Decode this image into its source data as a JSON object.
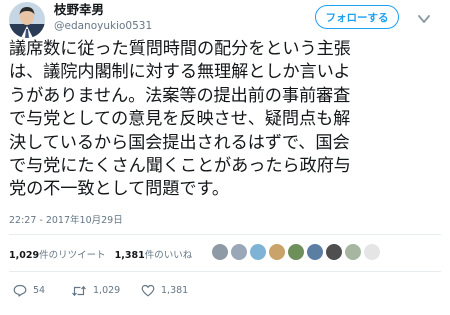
{
  "user": {
    "display_name": "枝野幸男",
    "handle": "@edanoyukio0531",
    "follow_label": "フォローする"
  },
  "tweet": {
    "lines": [
      "議席数に従った質問時間の配分をという主張",
      "は、議院内閣制に対する無理解としか言いよ",
      "うがありません。法案等の提出前の事前審査",
      "で与党としての意見を反映させ、疑問点も解",
      "決しているから国会提出されるはずで、国会",
      "で与党にたくさん聞くことがあったら政府与",
      "党の不一致として問題です。"
    ],
    "timestamp": "22:27 - 2017年10月29日"
  },
  "stats": {
    "retweets_count": "1,029",
    "retweets_label": "件のリツイート",
    "likes_count": "1,381",
    "likes_label": "件のいいね"
  },
  "liker_avatars": [
    {
      "icon": "liker-avatar",
      "color": "#8e9aa6"
    },
    {
      "icon": "liker-avatar",
      "color": "#9aa7b8"
    },
    {
      "icon": "liker-avatar",
      "color": "#7fb3d5"
    },
    {
      "icon": "liker-avatar",
      "color": "#c9a36a"
    },
    {
      "icon": "liker-avatar",
      "color": "#6d8f5a"
    },
    {
      "icon": "liker-avatar",
      "color": "#5b7fa3"
    },
    {
      "icon": "liker-avatar",
      "color": "#4f4f4f"
    },
    {
      "icon": "liker-avatar",
      "color": "#a7b6a0"
    },
    {
      "icon": "liker-avatar",
      "color": "#e5e5e5"
    }
  ],
  "actions": {
    "reply_count": "54",
    "retweet_count": "1,029",
    "like_count": "1,381"
  },
  "colors": {
    "accent": "#1da1f2",
    "muted": "#657786",
    "divider": "#e6ecf0"
  }
}
